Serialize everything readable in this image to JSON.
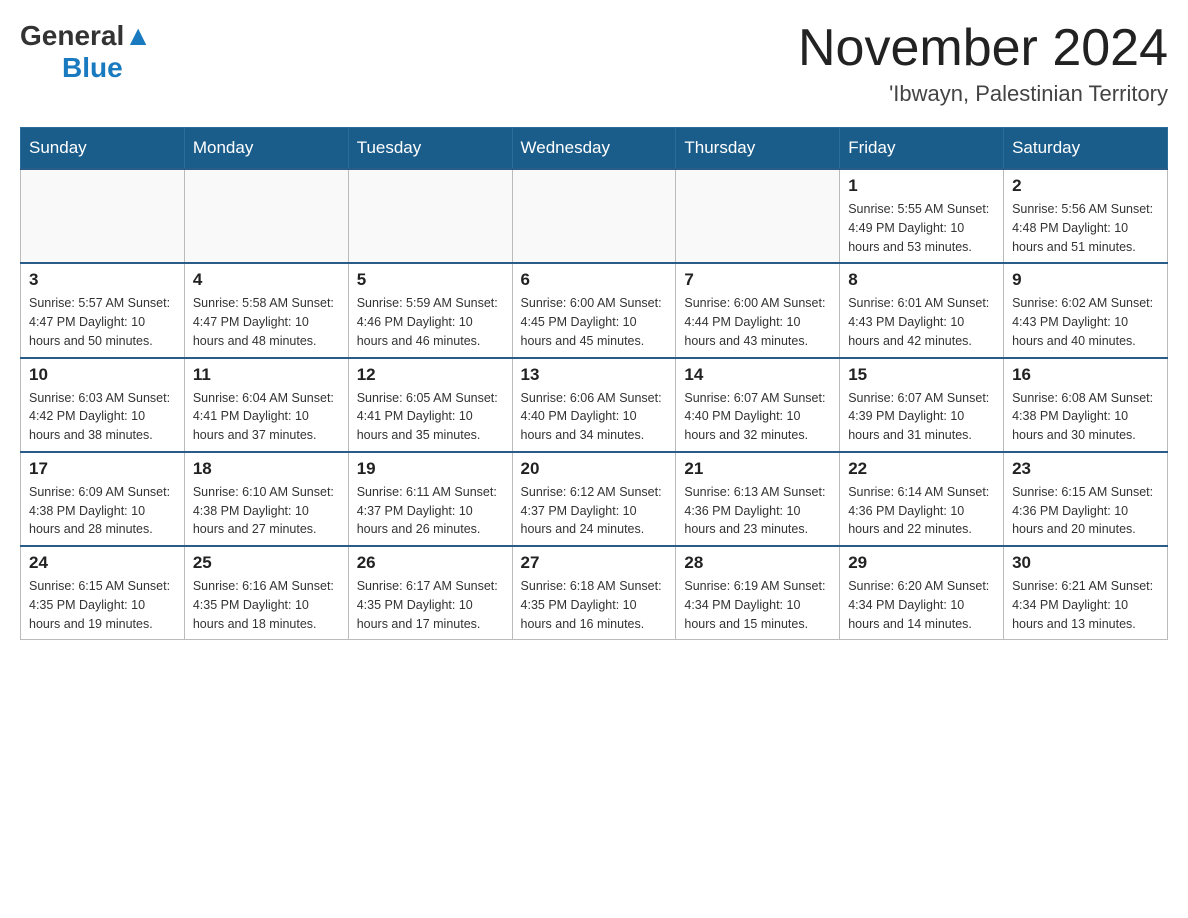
{
  "header": {
    "logo_general": "General",
    "logo_blue": "Blue",
    "month_title": "November 2024",
    "location": "'Ibwayn, Palestinian Territory"
  },
  "weekdays": [
    "Sunday",
    "Monday",
    "Tuesday",
    "Wednesday",
    "Thursday",
    "Friday",
    "Saturday"
  ],
  "weeks": [
    [
      {
        "day": "",
        "info": ""
      },
      {
        "day": "",
        "info": ""
      },
      {
        "day": "",
        "info": ""
      },
      {
        "day": "",
        "info": ""
      },
      {
        "day": "",
        "info": ""
      },
      {
        "day": "1",
        "info": "Sunrise: 5:55 AM\nSunset: 4:49 PM\nDaylight: 10 hours and 53 minutes."
      },
      {
        "day": "2",
        "info": "Sunrise: 5:56 AM\nSunset: 4:48 PM\nDaylight: 10 hours and 51 minutes."
      }
    ],
    [
      {
        "day": "3",
        "info": "Sunrise: 5:57 AM\nSunset: 4:47 PM\nDaylight: 10 hours and 50 minutes."
      },
      {
        "day": "4",
        "info": "Sunrise: 5:58 AM\nSunset: 4:47 PM\nDaylight: 10 hours and 48 minutes."
      },
      {
        "day": "5",
        "info": "Sunrise: 5:59 AM\nSunset: 4:46 PM\nDaylight: 10 hours and 46 minutes."
      },
      {
        "day": "6",
        "info": "Sunrise: 6:00 AM\nSunset: 4:45 PM\nDaylight: 10 hours and 45 minutes."
      },
      {
        "day": "7",
        "info": "Sunrise: 6:00 AM\nSunset: 4:44 PM\nDaylight: 10 hours and 43 minutes."
      },
      {
        "day": "8",
        "info": "Sunrise: 6:01 AM\nSunset: 4:43 PM\nDaylight: 10 hours and 42 minutes."
      },
      {
        "day": "9",
        "info": "Sunrise: 6:02 AM\nSunset: 4:43 PM\nDaylight: 10 hours and 40 minutes."
      }
    ],
    [
      {
        "day": "10",
        "info": "Sunrise: 6:03 AM\nSunset: 4:42 PM\nDaylight: 10 hours and 38 minutes."
      },
      {
        "day": "11",
        "info": "Sunrise: 6:04 AM\nSunset: 4:41 PM\nDaylight: 10 hours and 37 minutes."
      },
      {
        "day": "12",
        "info": "Sunrise: 6:05 AM\nSunset: 4:41 PM\nDaylight: 10 hours and 35 minutes."
      },
      {
        "day": "13",
        "info": "Sunrise: 6:06 AM\nSunset: 4:40 PM\nDaylight: 10 hours and 34 minutes."
      },
      {
        "day": "14",
        "info": "Sunrise: 6:07 AM\nSunset: 4:40 PM\nDaylight: 10 hours and 32 minutes."
      },
      {
        "day": "15",
        "info": "Sunrise: 6:07 AM\nSunset: 4:39 PM\nDaylight: 10 hours and 31 minutes."
      },
      {
        "day": "16",
        "info": "Sunrise: 6:08 AM\nSunset: 4:38 PM\nDaylight: 10 hours and 30 minutes."
      }
    ],
    [
      {
        "day": "17",
        "info": "Sunrise: 6:09 AM\nSunset: 4:38 PM\nDaylight: 10 hours and 28 minutes."
      },
      {
        "day": "18",
        "info": "Sunrise: 6:10 AM\nSunset: 4:38 PM\nDaylight: 10 hours and 27 minutes."
      },
      {
        "day": "19",
        "info": "Sunrise: 6:11 AM\nSunset: 4:37 PM\nDaylight: 10 hours and 26 minutes."
      },
      {
        "day": "20",
        "info": "Sunrise: 6:12 AM\nSunset: 4:37 PM\nDaylight: 10 hours and 24 minutes."
      },
      {
        "day": "21",
        "info": "Sunrise: 6:13 AM\nSunset: 4:36 PM\nDaylight: 10 hours and 23 minutes."
      },
      {
        "day": "22",
        "info": "Sunrise: 6:14 AM\nSunset: 4:36 PM\nDaylight: 10 hours and 22 minutes."
      },
      {
        "day": "23",
        "info": "Sunrise: 6:15 AM\nSunset: 4:36 PM\nDaylight: 10 hours and 20 minutes."
      }
    ],
    [
      {
        "day": "24",
        "info": "Sunrise: 6:15 AM\nSunset: 4:35 PM\nDaylight: 10 hours and 19 minutes."
      },
      {
        "day": "25",
        "info": "Sunrise: 6:16 AM\nSunset: 4:35 PM\nDaylight: 10 hours and 18 minutes."
      },
      {
        "day": "26",
        "info": "Sunrise: 6:17 AM\nSunset: 4:35 PM\nDaylight: 10 hours and 17 minutes."
      },
      {
        "day": "27",
        "info": "Sunrise: 6:18 AM\nSunset: 4:35 PM\nDaylight: 10 hours and 16 minutes."
      },
      {
        "day": "28",
        "info": "Sunrise: 6:19 AM\nSunset: 4:34 PM\nDaylight: 10 hours and 15 minutes."
      },
      {
        "day": "29",
        "info": "Sunrise: 6:20 AM\nSunset: 4:34 PM\nDaylight: 10 hours and 14 minutes."
      },
      {
        "day": "30",
        "info": "Sunrise: 6:21 AM\nSunset: 4:34 PM\nDaylight: 10 hours and 13 minutes."
      }
    ]
  ]
}
